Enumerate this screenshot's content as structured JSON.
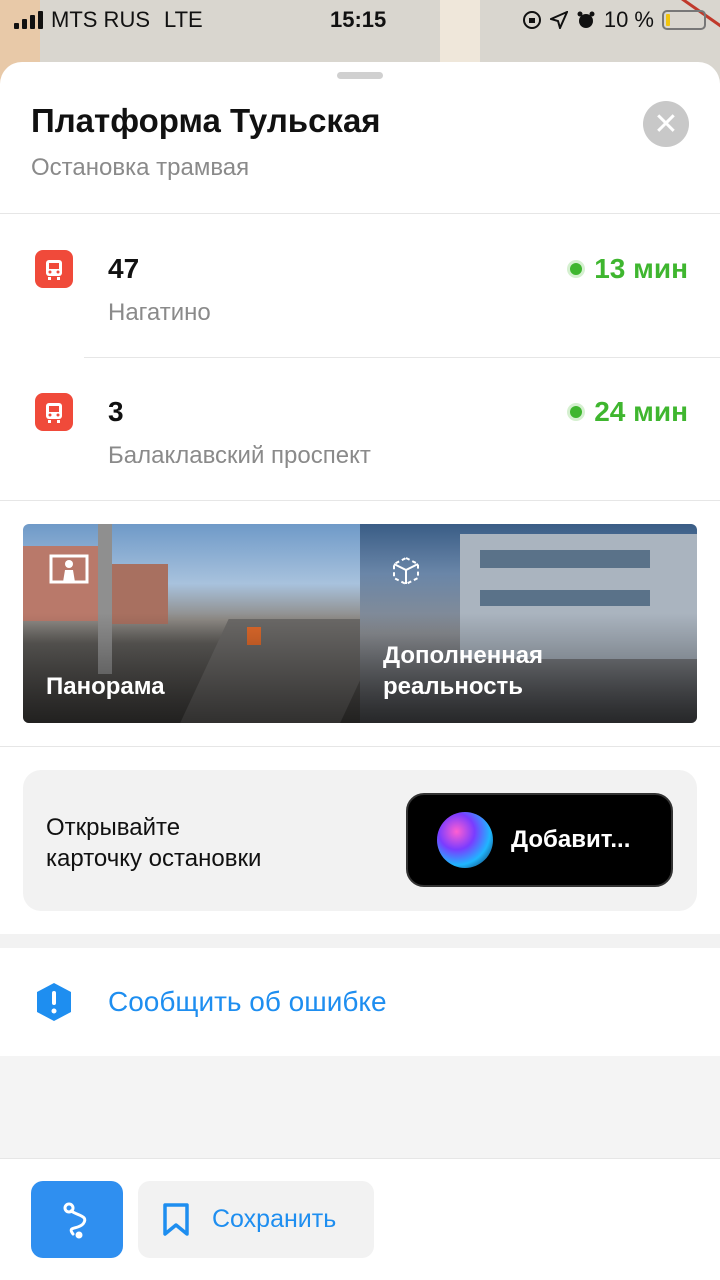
{
  "status_bar": {
    "carrier": "MTS RUS",
    "network": "LTE",
    "time": "15:15",
    "battery_percent": "10 %",
    "battery_level": 0.1
  },
  "stop": {
    "title": "Платформа Тульская",
    "subtitle": "Остановка трамвая"
  },
  "routes": [
    {
      "number": "47",
      "destination": "Нагатино",
      "eta": "13 мин"
    },
    {
      "number": "3",
      "destination": "Балаклавский проспект",
      "eta": "24 мин"
    }
  ],
  "media": {
    "panorama_label": "Панорама",
    "ar_label": "Дополненная\nреальность"
  },
  "siri": {
    "text": "Открывайте\nкарточку остановки",
    "button_label": "Добавит..."
  },
  "report": {
    "label": "Сообщить об ошибке"
  },
  "bottom_bar": {
    "save_label": "Сохранить"
  },
  "colors": {
    "accent": "#1e8ef0",
    "tram": "#f04a3a",
    "eta": "#3fb62f"
  }
}
